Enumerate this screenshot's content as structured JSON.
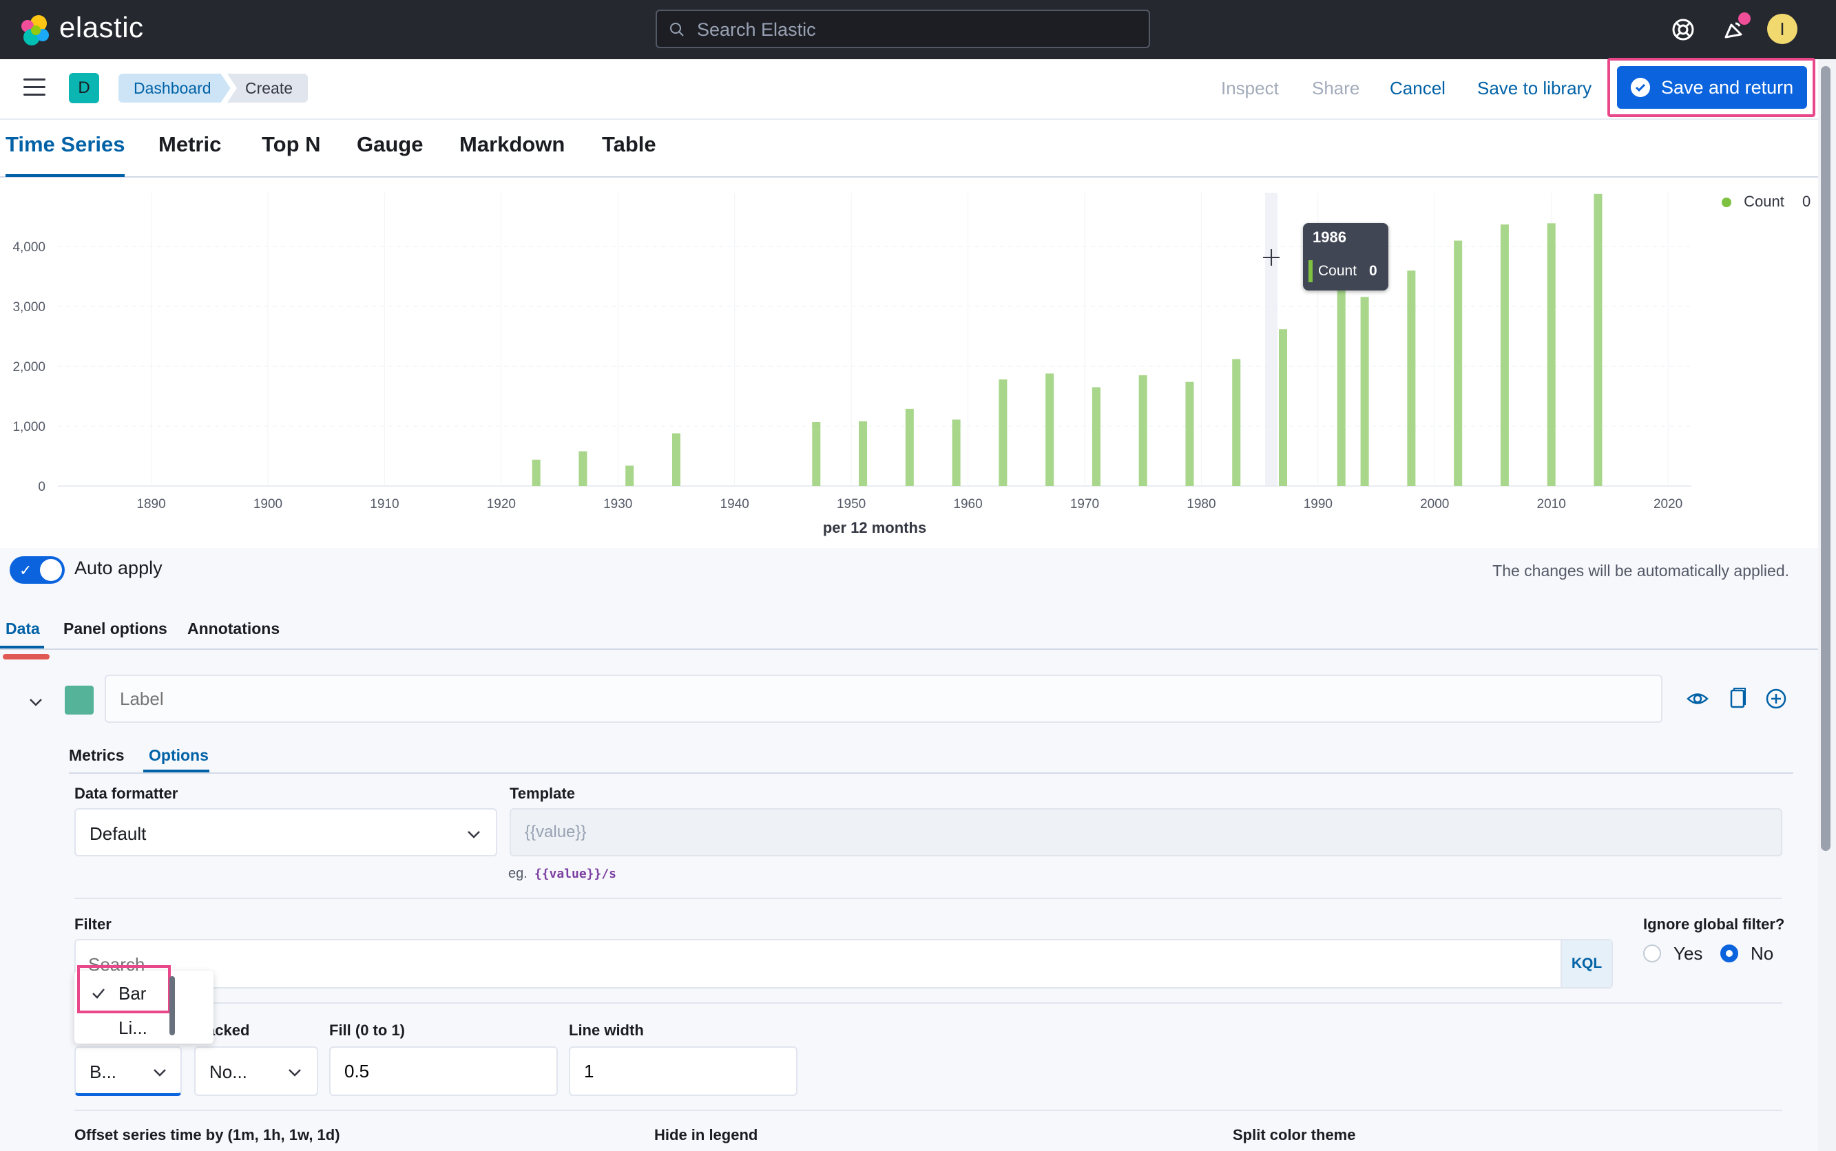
{
  "header": {
    "brand": "elastic",
    "search_placeholder": "Search Elastic",
    "user_initial": "I"
  },
  "subbar": {
    "space_initial": "D",
    "breadcrumbs": [
      "Dashboard",
      "Create"
    ],
    "actions": {
      "inspect": "Inspect",
      "share": "Share",
      "cancel": "Cancel",
      "save_to_library": "Save to library",
      "save_and_return": "Save and return"
    }
  },
  "vis_tabs": [
    "Time Series",
    "Metric",
    "Top N",
    "Gauge",
    "Markdown",
    "Table"
  ],
  "chart_data": {
    "type": "bar",
    "xlabel": "per 12 months",
    "ylabel": "",
    "x_ticks": [
      "1890",
      "1900",
      "1910",
      "1920",
      "1930",
      "1940",
      "1950",
      "1960",
      "1970",
      "1980",
      "1990",
      "2000",
      "2010",
      "2020"
    ],
    "y_ticks": [
      "0",
      "1,000",
      "2,000",
      "3,000",
      "4,000"
    ],
    "xlim": [
      1882,
      2022
    ],
    "ylim": [
      0,
      4900
    ],
    "series": [
      {
        "name": "Count",
        "x": [
          1923,
          1927,
          1931,
          1935,
          1947,
          1951,
          1955,
          1959,
          1963,
          1967,
          1971,
          1975,
          1979,
          1983,
          1987,
          1992,
          1994,
          1998,
          2002,
          2006,
          2010,
          2014
        ],
        "values": [
          440,
          580,
          340,
          880,
          1070,
          1080,
          1290,
          1110,
          1780,
          1880,
          1650,
          1850,
          1740,
          2120,
          2620,
          3500,
          3160,
          3600,
          4100,
          4370,
          4390,
          4880
        ]
      }
    ],
    "legend": {
      "label": "Count",
      "value": "0",
      "position": "top-right",
      "color": "#7fc242"
    },
    "tooltip": {
      "title": "1986",
      "label": "Count",
      "value": "0"
    },
    "grid": true
  },
  "auto_apply": {
    "label": "Auto apply",
    "note": "The changes will be automatically applied."
  },
  "data_tabs": [
    "Data",
    "Panel options",
    "Annotations"
  ],
  "series": {
    "label_placeholder": "Label",
    "sub_tabs": [
      "Metrics",
      "Options"
    ],
    "data_formatter": {
      "label": "Data formatter",
      "value": "Default"
    },
    "template": {
      "label": "Template",
      "placeholder": "{{value}}",
      "example_prefix": "eg.",
      "example": "{{value}}/s"
    },
    "filter": {
      "label": "Filter",
      "placeholder": "Search",
      "language": "KQL"
    },
    "ignore_global": {
      "label": "Ignore global filter?",
      "yes": "Yes",
      "no": "No"
    },
    "chart_type": {
      "value": "B...",
      "options": [
        "Bar",
        "Li..."
      ]
    },
    "stacked": {
      "label": "acked",
      "value": "No..."
    },
    "fill": {
      "label": "Fill (0 to 1)",
      "value": "0.5"
    },
    "line_width": {
      "label": "Line width",
      "value": "1"
    },
    "offset_label": "Offset series time by (1m, 1h, 1w, 1d)",
    "hide_legend_label": "Hide in legend",
    "split_color_label": "Split color theme"
  }
}
